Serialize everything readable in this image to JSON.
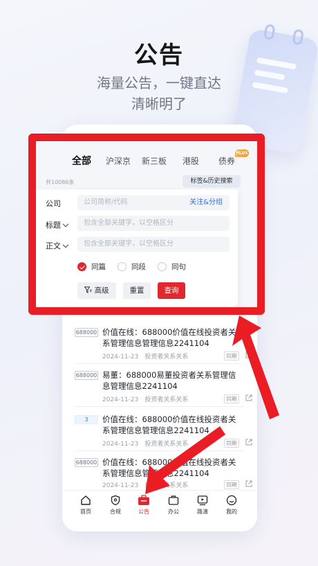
{
  "hero": {
    "title": "公告",
    "subtitle_line1": "海量公告，一键直达",
    "subtitle_line2": "清晰明了"
  },
  "categories": [
    "全部",
    "沪深京",
    "新三板",
    "港股",
    "债券"
  ],
  "plus_badge": "PLUS",
  "count_text": "共10086条",
  "history_button": "标签&历史搜索",
  "filter": {
    "company_label": "公司",
    "company_placeholder": "公司简称/代码",
    "follow_link": "关注&分组",
    "title_label": "标题",
    "title_placeholder": "包含全部关键字，以空格区分",
    "body_label": "正文",
    "body_placeholder": "包含全部关键字，以空格区分",
    "match_options": [
      "同篇",
      "同段",
      "同句"
    ],
    "selected_match": "同篇",
    "advanced_button": "高级",
    "reset_button": "重置",
    "search_button": "查询"
  },
  "list": [
    {
      "code": "688000",
      "title": "价值在线：688000价值在线投资者关系管理信息管理信息2241104",
      "date": "2024-11-23",
      "source": "投资者关系关系",
      "tag": "同期"
    },
    {
      "code": "688000",
      "title": "易董：688000易董投资者关系管理信息管理信息2241104",
      "date": "2024-11-23",
      "source": "投资者关系关系",
      "tag": "同期"
    },
    {
      "code": "3",
      "title": "价值在线：688000价值在线投资者关系管理信息管理信息2241104",
      "date": "2024-11-23",
      "source": "投资者关系关系",
      "tag": "同期"
    },
    {
      "code": "688000",
      "title": "价值在线：688000价值在线投资者关系管理信息管理信息2241104",
      "date": "2024-11-23",
      "source": "投资者关系关系",
      "tag": "同期"
    }
  ],
  "tabbar": [
    {
      "label": "首页",
      "icon": "home-icon"
    },
    {
      "label": "合规",
      "icon": "shield-icon"
    },
    {
      "label": "公告",
      "icon": "announcement-icon"
    },
    {
      "label": "办公",
      "icon": "briefcase-icon"
    },
    {
      "label": "路演",
      "icon": "video-icon"
    },
    {
      "label": "我的",
      "icon": "profile-icon"
    }
  ],
  "active_tab": "公告",
  "colors": {
    "accent": "#e0282e",
    "frame": "#ea1c24",
    "link": "#2f6fd9"
  }
}
